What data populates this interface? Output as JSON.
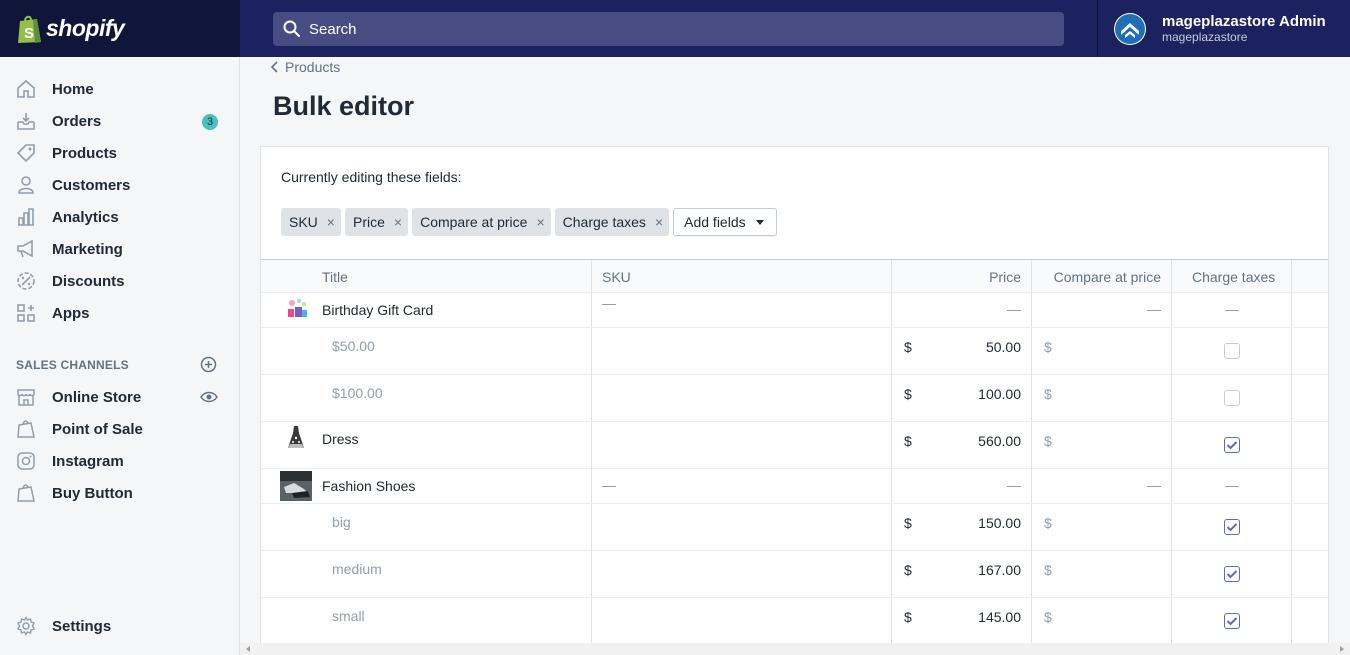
{
  "brand": {
    "name": "shopify"
  },
  "search": {
    "placeholder": "Search"
  },
  "account": {
    "name": "mageplazastore Admin",
    "store": "mageplazastore"
  },
  "sidebar": {
    "items": [
      {
        "label": "Home",
        "icon": "home-icon"
      },
      {
        "label": "Orders",
        "icon": "orders-icon",
        "badge": "3"
      },
      {
        "label": "Products",
        "icon": "tag-icon"
      },
      {
        "label": "Customers",
        "icon": "person-icon"
      },
      {
        "label": "Analytics",
        "icon": "bar-chart-icon"
      },
      {
        "label": "Marketing",
        "icon": "megaphone-icon"
      },
      {
        "label": "Discounts",
        "icon": "discount-icon"
      },
      {
        "label": "Apps",
        "icon": "apps-icon"
      }
    ],
    "sales_channels_heading": "SALES CHANNELS",
    "channels": [
      {
        "label": "Online Store",
        "icon": "store-icon"
      },
      {
        "label": "Point of Sale",
        "icon": "shopping-bag-icon"
      },
      {
        "label": "Instagram",
        "icon": "instagram-icon"
      },
      {
        "label": "Buy Button",
        "icon": "shopping-bag-icon"
      }
    ],
    "settings_label": "Settings"
  },
  "breadcrumb": {
    "label": "Products"
  },
  "page": {
    "title": "Bulk editor"
  },
  "editor": {
    "editing_label": "Currently editing these fields:",
    "fields": [
      "SKU",
      "Price",
      "Compare at price",
      "Charge taxes"
    ],
    "remove_glyph": "×",
    "add_fields_label": "Add fields"
  },
  "grid": {
    "headers": {
      "title": "Title",
      "sku": "SKU",
      "price": "Price",
      "compare": "Compare at price",
      "tax": "Charge taxes"
    },
    "currency": "$",
    "rows": [
      {
        "kind": "product",
        "title": "Birthday Gift Card",
        "thumb": "gift-card-thumbnail"
      },
      {
        "kind": "variant",
        "title": "$50.00",
        "price": "50.00",
        "charge_taxes": false
      },
      {
        "kind": "variant",
        "title": "$100.00",
        "price": "100.00",
        "charge_taxes": false
      },
      {
        "kind": "single",
        "title": "Dress",
        "thumb": "dress-thumbnail",
        "price": "560.00",
        "charge_taxes": true
      },
      {
        "kind": "product",
        "title": "Fashion Shoes",
        "thumb": "shoes-thumbnail"
      },
      {
        "kind": "variant",
        "title": "big",
        "price": "150.00",
        "charge_taxes": true
      },
      {
        "kind": "variant",
        "title": "medium",
        "price": "167.00",
        "charge_taxes": true
      },
      {
        "kind": "variant",
        "title": "small",
        "price": "145.00",
        "charge_taxes": true
      }
    ]
  },
  "colors": {
    "topbar": "#1c2260",
    "accent": "#5c6ac4",
    "badge": "#47c1bf"
  }
}
